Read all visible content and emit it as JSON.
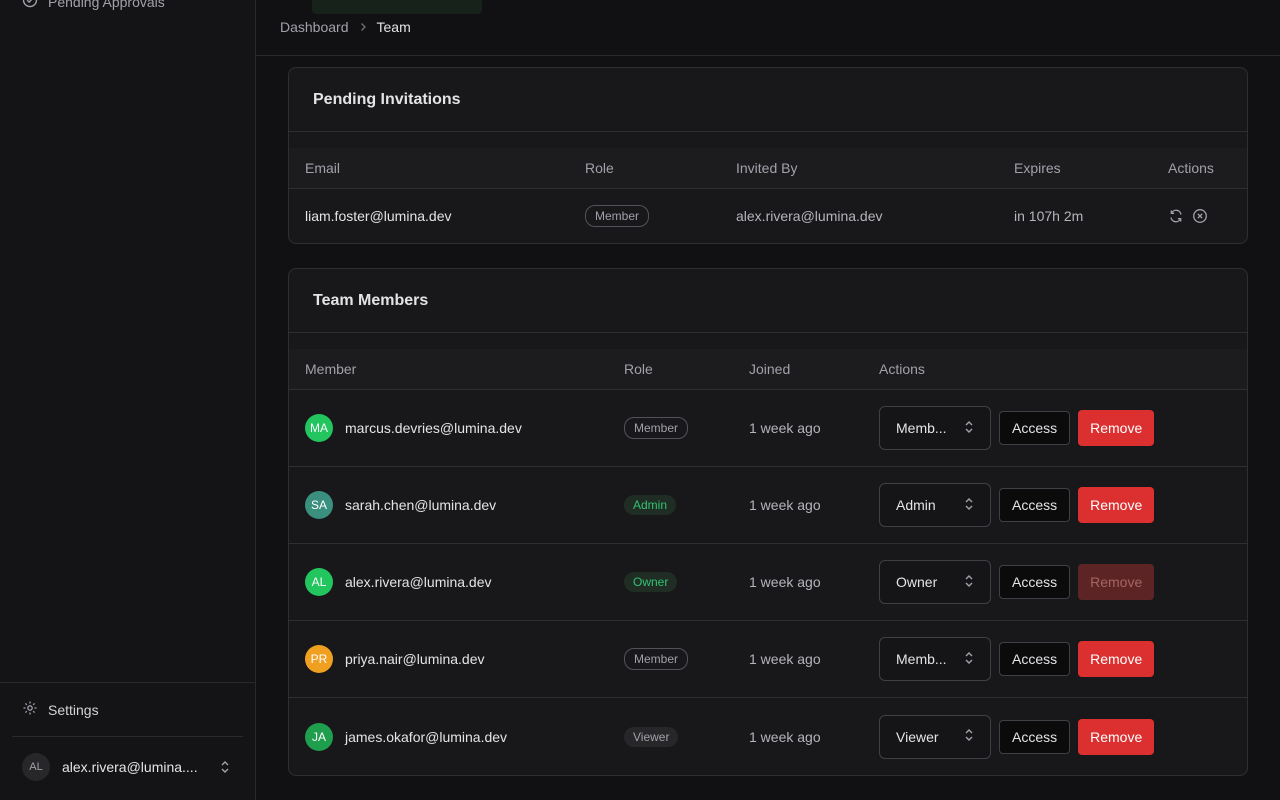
{
  "sidebar": {
    "top_item": "Pending Approvals",
    "settings_label": "Settings",
    "user": {
      "initials": "AL",
      "email": "alex.rivera@lumina...."
    }
  },
  "breadcrumb": {
    "root": "Dashboard",
    "current": "Team"
  },
  "invitations": {
    "title": "Pending Invitations",
    "columns": [
      "Email",
      "Role",
      "Invited By",
      "Expires",
      "Actions"
    ],
    "rows": [
      {
        "email": "liam.foster@lumina.dev",
        "role": "Member",
        "invited_by": "alex.rivera@lumina.dev",
        "expires": "in 107h 2m"
      }
    ]
  },
  "members": {
    "title": "Team Members",
    "columns": [
      "Member",
      "Role",
      "Joined",
      "Actions"
    ],
    "access_label": "Access",
    "remove_label": "Remove",
    "rows": [
      {
        "initials": "MA",
        "avatar_color": "#22c55e",
        "email": "marcus.devries@lumina.dev",
        "role": "Member",
        "joined": "1 week ago",
        "select_value": "Memb...",
        "remove_disabled": false
      },
      {
        "initials": "SA",
        "avatar_color": "#3b8f7e",
        "email": "sarah.chen@lumina.dev",
        "role": "Admin",
        "joined": "1 week ago",
        "select_value": "Admin",
        "remove_disabled": false
      },
      {
        "initials": "AL",
        "avatar_color": "#22c55e",
        "email": "alex.rivera@lumina.dev",
        "role": "Owner",
        "joined": "1 week ago",
        "select_value": "Owner",
        "remove_disabled": true
      },
      {
        "initials": "PR",
        "avatar_color": "#f0a020",
        "email": "priya.nair@lumina.dev",
        "role": "Member",
        "joined": "1 week ago",
        "select_value": "Memb...",
        "remove_disabled": false
      },
      {
        "initials": "JA",
        "avatar_color": "#1f9e4e",
        "email": "james.okafor@lumina.dev",
        "role": "Viewer",
        "joined": "1 week ago",
        "select_value": "Viewer",
        "remove_disabled": false
      }
    ]
  }
}
